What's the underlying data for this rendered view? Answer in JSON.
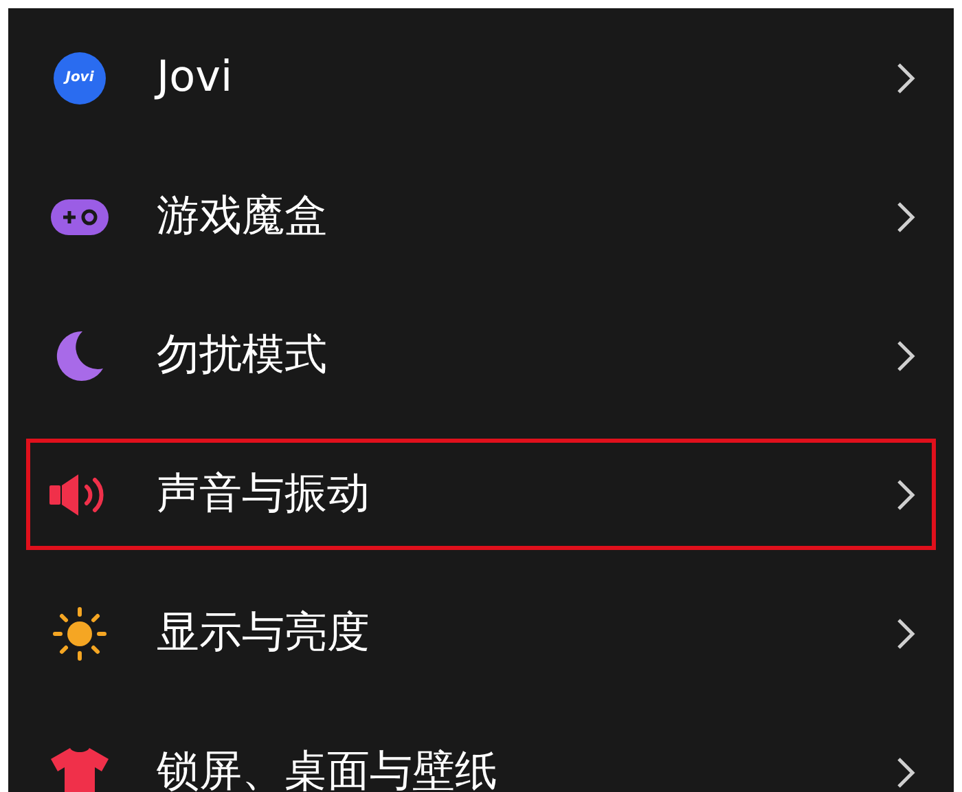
{
  "settings": [
    {
      "kind": "jovi",
      "icon_text": "Jovi",
      "label": "Jovi",
      "highlighted": false
    },
    {
      "kind": "game",
      "label": "游戏魔盒",
      "highlighted": false
    },
    {
      "kind": "moon",
      "label": "勿扰模式",
      "highlighted": false
    },
    {
      "kind": "speaker",
      "label": "声音与振动",
      "highlighted": true
    },
    {
      "kind": "sun",
      "label": "显示与亮度",
      "highlighted": false
    },
    {
      "kind": "shirt",
      "label": "锁屏、桌面与壁纸",
      "highlighted": false
    }
  ]
}
